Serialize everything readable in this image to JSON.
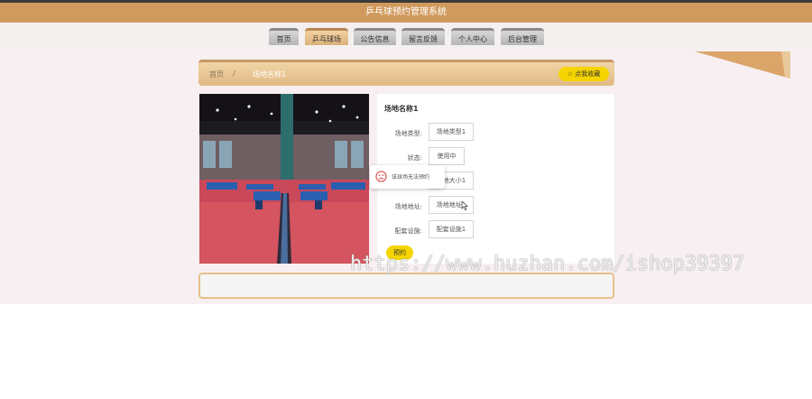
{
  "header": {
    "title": "乒乓球预约管理系统"
  },
  "nav": {
    "items": [
      {
        "label": "首页"
      },
      {
        "label": "乒乓球场",
        "active": true
      },
      {
        "label": "公告信息"
      },
      {
        "label": "留言反馈"
      },
      {
        "label": "个人中心"
      },
      {
        "label": "后台管理"
      }
    ]
  },
  "breadcrumb": {
    "home": "首页",
    "separator": "/",
    "current": "场地名称1"
  },
  "collect_button": {
    "label": "☆ 点我收藏"
  },
  "detail": {
    "title": "场地名称1",
    "rows": [
      {
        "label": "场地类型:",
        "value": "场地类型1"
      },
      {
        "label": "状态:",
        "value": "使用中"
      },
      {
        "label": "",
        "value": "场地大小1"
      },
      {
        "label": "场地地址:",
        "value": "场地地址1"
      },
      {
        "label": "配套设施:",
        "value": "配套设施1"
      }
    ],
    "reserve_label": "预约"
  },
  "toast": {
    "text": "该球场无法预约",
    "icon": "sad-face-icon"
  },
  "watermark": "https://www.huzhan.com/ishop39397",
  "colors": {
    "header": "#d09a5d",
    "accent_yellow": "#f5d400",
    "breadcrumb_bar": "#e0b985",
    "page_bg": "#f7eff1"
  }
}
